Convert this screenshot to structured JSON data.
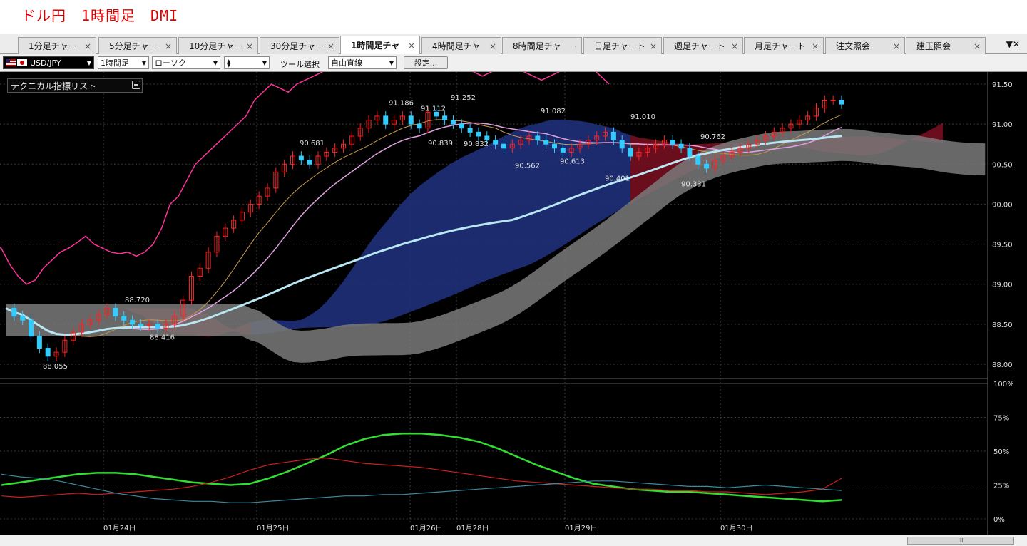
{
  "page_title": "ドル円　1時間足　DMI",
  "tabs": [
    {
      "label": "1分足チャー",
      "close": "×"
    },
    {
      "label": "5分足チャー",
      "close": "×"
    },
    {
      "label": "10分足チャー",
      "close": "×"
    },
    {
      "label": "30分足チャー",
      "close": "×"
    },
    {
      "label": "1時間足チャ",
      "close": "×"
    },
    {
      "label": "4時間足チャ",
      "close": "×"
    },
    {
      "label": "8時間足チャ",
      "close": "·"
    },
    {
      "label": "日足チャート",
      "close": "×"
    },
    {
      "label": "週足チャート",
      "close": "×"
    },
    {
      "label": "月足チャート",
      "close": "×"
    },
    {
      "label": "注文照会",
      "close": "×"
    },
    {
      "label": "建玉照会",
      "close": "×"
    }
  ],
  "active_tab": 4,
  "tab_menu_glyph": "▼✕",
  "toolbar": {
    "pair": "USD/JPY",
    "timeframe": "1時間足",
    "chart_type": "ローソク",
    "style_glyph": "⧫",
    "tool_label": "ツール選択",
    "tool_value": "自由直線",
    "settings_button": "設定..."
  },
  "indicator_list_label": "テクニカル指標リスト",
  "colors": {
    "bullish": "#ff2020",
    "bearish": "#33ccff",
    "cloud_red": "#7d0f22",
    "cloud_blue": "#1f2f7a",
    "cloud_gray": "#7a7a7a",
    "pink_line": "#ff3399",
    "light_blue_ma": "#b8e6f2",
    "plus_di": "#cc1f1f",
    "minus_di": "#3a8aa0",
    "adx": "#33dd33"
  },
  "chart_data": [
    {
      "type": "candlestick",
      "pair": "USD/JPY",
      "timeframe": "1時間足",
      "y_ticks": [
        "91.50",
        "91.00",
        "90.50",
        "90.00",
        "89.50",
        "89.00",
        "88.50",
        "88.00"
      ],
      "ylim": [
        88.0,
        91.5
      ],
      "x_labels": [
        "01月24日",
        "01月25日",
        "01月26日",
        "01月28日",
        "01月29日",
        "01月30日"
      ],
      "annotations": [
        {
          "label": "88.055",
          "value": 88.055
        },
        {
          "label": "88.720",
          "value": 88.72
        },
        {
          "label": "88.416",
          "value": 88.416
        },
        {
          "label": "90.681",
          "value": 90.681
        },
        {
          "label": "91.186",
          "value": 91.186
        },
        {
          "label": "91.112",
          "value": 91.112
        },
        {
          "label": "91.252",
          "value": 91.252
        },
        {
          "label": "90.839",
          "value": 90.839
        },
        {
          "label": "90.832",
          "value": 90.832
        },
        {
          "label": "91.082",
          "value": 91.082
        },
        {
          "label": "90.562",
          "value": 90.562
        },
        {
          "label": "90.613",
          "value": 90.613
        },
        {
          "label": "91.010",
          "value": 91.01
        },
        {
          "label": "90.401",
          "value": 90.401
        },
        {
          "label": "90.762",
          "value": 90.762
        },
        {
          "label": "90.331",
          "value": 90.331
        }
      ],
      "close_path": [
        88.7,
        88.6,
        88.55,
        88.35,
        88.2,
        88.1,
        88.15,
        88.3,
        88.4,
        88.5,
        88.55,
        88.62,
        88.7,
        88.6,
        88.55,
        88.5,
        88.48,
        88.5,
        88.45,
        88.5,
        88.6,
        88.8,
        89.1,
        89.2,
        89.4,
        89.6,
        89.7,
        89.8,
        89.9,
        90.0,
        90.1,
        90.2,
        90.4,
        90.5,
        90.6,
        90.55,
        90.5,
        90.6,
        90.65,
        90.7,
        90.75,
        90.85,
        90.95,
        91.05,
        91.1,
        91.0,
        91.05,
        91.1,
        91.0,
        90.95,
        91.15,
        91.1,
        91.05,
        91.0,
        90.95,
        90.9,
        90.85,
        90.8,
        90.75,
        90.7,
        90.75,
        90.8,
        90.85,
        90.8,
        90.75,
        90.7,
        90.65,
        90.7,
        90.75,
        90.8,
        90.85,
        90.9,
        90.8,
        90.7,
        90.6,
        90.65,
        90.7,
        90.75,
        90.8,
        90.75,
        90.7,
        90.6,
        90.5,
        90.45,
        90.55,
        90.6,
        90.65,
        90.7,
        90.75,
        90.8,
        90.85,
        90.9,
        90.95,
        91.0,
        91.05,
        91.1,
        91.2,
        91.3,
        91.3,
        91.25
      ]
    },
    {
      "type": "line",
      "title": "DMI",
      "y_ticks": [
        "100%",
        "75%",
        "50%",
        "25%",
        "0%"
      ],
      "ylim": [
        0,
        100
      ],
      "series": [
        {
          "values": [
            25,
            27,
            29,
            31,
            33,
            34,
            34,
            33,
            31,
            29,
            27,
            26,
            25,
            26,
            30,
            35,
            41,
            47,
            54,
            59,
            62,
            63,
            63,
            62,
            60,
            57,
            52,
            46,
            40,
            35,
            30,
            26,
            24,
            22,
            21,
            20,
            20,
            19,
            18,
            17,
            16,
            15,
            14,
            13,
            14
          ]
        },
        {
          "values": [
            17,
            16,
            17,
            18,
            19,
            18,
            19,
            20,
            21,
            22,
            24,
            27,
            31,
            36,
            40,
            42,
            44,
            45,
            43,
            41,
            40,
            39,
            38,
            36,
            34,
            32,
            30,
            28,
            27,
            26,
            25,
            24,
            23,
            22,
            22,
            21,
            21,
            20,
            20,
            19,
            18,
            19,
            20,
            22,
            30
          ]
        },
        {
          "values": [
            33,
            31,
            30,
            28,
            25,
            22,
            19,
            17,
            15,
            14,
            13,
            13,
            12,
            12,
            13,
            14,
            15,
            16,
            17,
            17,
            18,
            18,
            19,
            20,
            21,
            22,
            23,
            24,
            25,
            26,
            27,
            28,
            28,
            27,
            26,
            25,
            24,
            24,
            23,
            24,
            25,
            24,
            23,
            22,
            21
          ]
        }
      ]
    }
  ],
  "scrollbar_glyph": "III"
}
